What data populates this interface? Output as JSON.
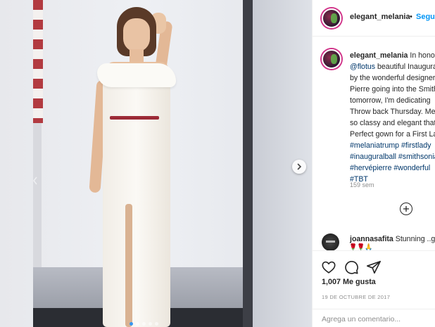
{
  "header": {
    "username": "elegant_melania",
    "separator": "•",
    "follow_label": "Seguir"
  },
  "caption": {
    "username": "elegant_melania",
    "lines": [
      "In honor of",
      "@flotus beautiful Inaugural",
      "by the wonderful designer",
      "Pierre going into the Smithsonian",
      "tomorrow, I'm dedicating",
      "Throw back Thursday. Me",
      "so classy and elegant that",
      "Perfect gown for a First Lady"
    ],
    "tag_lines": [
      "#melaniatrump #firstlady",
      "#inauguralball #smithsonian",
      "#hervépierre #wonderful",
      "#TBT"
    ],
    "time": "159 sem"
  },
  "comment": {
    "username": "joannasafita",
    "text": "Stunning ..g",
    "emoji": "🌹🌹🙏"
  },
  "actions": {
    "like_icon": "heart-icon",
    "comment_icon": "comment-icon",
    "share_icon": "share-icon",
    "likes": "1,007 Me gusta",
    "date": "19 DE OCTUBRE DE 2017",
    "comment_placeholder": "Agrega un comentario..."
  },
  "media": {
    "next_icon": "chevron-right-icon",
    "carousel_dots": 5,
    "active_dot": 0
  },
  "colors": {
    "accent": "#0095f6",
    "text": "#262626",
    "muted": "#8e8e8e",
    "hashtag": "#00376b"
  }
}
